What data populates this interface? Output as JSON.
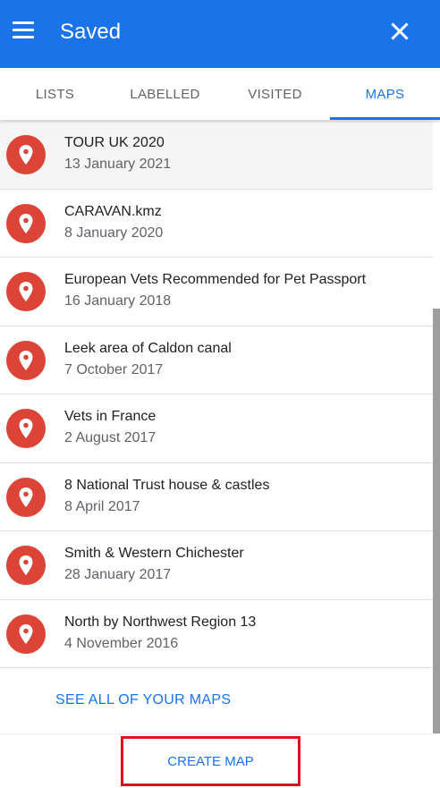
{
  "header": {
    "title": "Saved",
    "menu_icon": "hamburger-menu-icon",
    "close_icon": "close-icon",
    "color": "#1a73e8"
  },
  "tabs": [
    {
      "label": "LISTS",
      "active": false
    },
    {
      "label": "LABELLED",
      "active": false
    },
    {
      "label": "VISITED",
      "active": false
    },
    {
      "label": "MAPS",
      "active": true
    }
  ],
  "maps": [
    {
      "name": "TOUR UK 2020",
      "date": "13 January 2021"
    },
    {
      "name": "CARAVAN.kmz",
      "date": "8 January 2020"
    },
    {
      "name": "European Vets Recommended for Pet Passport",
      "date": "16 January 2018"
    },
    {
      "name": "Leek area of Caldon canal",
      "date": "7 October 2017"
    },
    {
      "name": "Vets in France",
      "date": "2 August 2017"
    },
    {
      "name": "8 National Trust house & castles",
      "date": "8 April 2017"
    },
    {
      "name": "Smith & Western Chichester",
      "date": "28 January 2017"
    },
    {
      "name": "North by Northwest Region 13",
      "date": "4 November 2016"
    }
  ],
  "see_all_label": "SEE ALL OF YOUR MAPS",
  "create_map_label": "CREATE MAP",
  "pin_icon": "map-pin-icon",
  "pin_color": "#db4437",
  "highlight_color": "#e0101e"
}
